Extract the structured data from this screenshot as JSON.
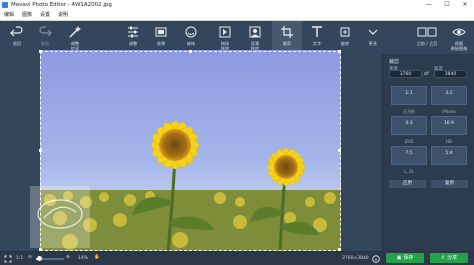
{
  "window": {
    "title": "Movavi Photo Editor - 4W1A2002.jpg",
    "min": "—",
    "max": "☐",
    "close": "✕"
  },
  "menu": [
    "编辑",
    "图像",
    "设置",
    "说明"
  ],
  "toolbar": {
    "undo": "退回",
    "redo": "重做",
    "items": [
      {
        "label": "调整\n优化",
        "icon": "magic-wand-icon"
      },
      {
        "label": "调整",
        "icon": "sliders-icon"
      },
      {
        "label": "效果",
        "icon": "filter-icon"
      },
      {
        "label": "修饰",
        "icon": "retouch-icon"
      },
      {
        "label": "物体\n移除",
        "icon": "object-removal-icon"
      },
      {
        "label": "背景\n移除",
        "icon": "background-removal-icon"
      },
      {
        "label": "裁剪",
        "icon": "crop-icon"
      },
      {
        "label": "文字",
        "icon": "text-icon"
      },
      {
        "label": "旋转",
        "icon": "rotate-icon"
      },
      {
        "label": "更多",
        "icon": "chevron-down-icon"
      }
    ],
    "before_after": "之前 / 之后",
    "view": "视图\n原始图像"
  },
  "panel": {
    "title": "裁剪",
    "width_label": "宽度",
    "height_label": "高度",
    "width": "3760",
    "height": "3840",
    "ratios": [
      {
        "label": "1:1",
        "sub": "正方形"
      },
      {
        "label": "3:2",
        "sub": "iPhone"
      },
      {
        "label": "4:3",
        "sub": "DVD"
      },
      {
        "label": "16:9",
        "sub": "HD"
      },
      {
        "label": "7:5",
        "sub": "L, 2L"
      },
      {
        "label": "5:4",
        "sub": ""
      }
    ],
    "apply": "应用",
    "reset": "复原"
  },
  "status": {
    "fit": "1:1",
    "zoom_label": "⊖",
    "zoom_in": "⊕",
    "zoom": "14%",
    "zoom_fraction": 0.14,
    "dimensions": "3760×3840",
    "save": "保存",
    "share": "分享"
  },
  "colors": {
    "toolbar": "#34465c",
    "canvas": "#34465a",
    "panel": "#2c3b4e",
    "save": "#22a34a",
    "accent": "#6fa2d8"
  }
}
